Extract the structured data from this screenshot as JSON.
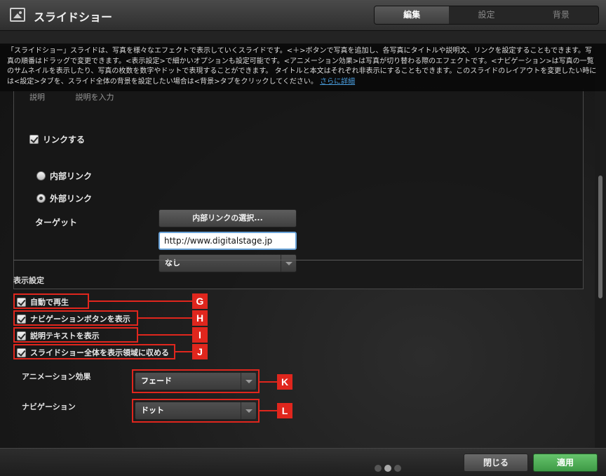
{
  "app": {
    "title": "スライドショー",
    "icon": "image-icon"
  },
  "tabs": [
    {
      "label": "編集",
      "active": true
    },
    {
      "label": "設定",
      "active": false
    },
    {
      "label": "背景",
      "active": false
    }
  ],
  "info": {
    "text": "「スライドショー」スライドは、写真を様々なエフェクトで表示していくスライドです。<＋>ボタンで写真を追加し、各写真にタイトルや説明文、リンクを設定することもできます。写真の順番はドラッグで変更できます。<表示設定>で細かいオプションも設定可能です。<アニメーション効果>は写真が切り替わる際のエフェクトです。<ナビゲーション>は写真の一覧のサムネイルを表示したり、写真の枚数を数字やドットで表現することができます。 タイトルと本文はそれぞれ非表示にすることもできます。このスライドのレイアウトを変更したい時には<設定>タブを、スライド全体の背景を設定したい場合は<背景>タブをクリックしてください。",
    "more_link": "さらに詳細"
  },
  "link_panel": {
    "desc_label": "説明",
    "desc_placeholder": "説明を入力",
    "link_checkbox_label": "リンクする",
    "link_checked": true,
    "internal_link_label": "内部リンク",
    "internal_link_button": "内部リンクの選択...",
    "external_link_label": "外部リンク",
    "external_selected": true,
    "url_value": "http://www.digitalstage.jp",
    "target_label": "ターゲット",
    "target_value": "なし"
  },
  "display_settings": {
    "title": "表示設定",
    "options": [
      {
        "label": "自動で再生",
        "checked": true,
        "badge": "G"
      },
      {
        "label": "ナビゲーションボタンを表示",
        "checked": true,
        "badge": "H"
      },
      {
        "label": "説明テキストを表示",
        "checked": true,
        "badge": "I"
      },
      {
        "label": "スライドショー全体を表示領域に収める",
        "checked": true,
        "badge": "J"
      }
    ],
    "animation_label": "アニメーション効果",
    "animation_value": "フェード",
    "animation_badge": "K",
    "navigation_label": "ナビゲーション",
    "navigation_value": "ドット",
    "navigation_badge": "L"
  },
  "footer": {
    "close_label": "閉じる",
    "apply_label": "適用"
  },
  "colors": {
    "highlight": "#e0261d",
    "apply": "#4eae56",
    "link": "#4a9fe0"
  }
}
